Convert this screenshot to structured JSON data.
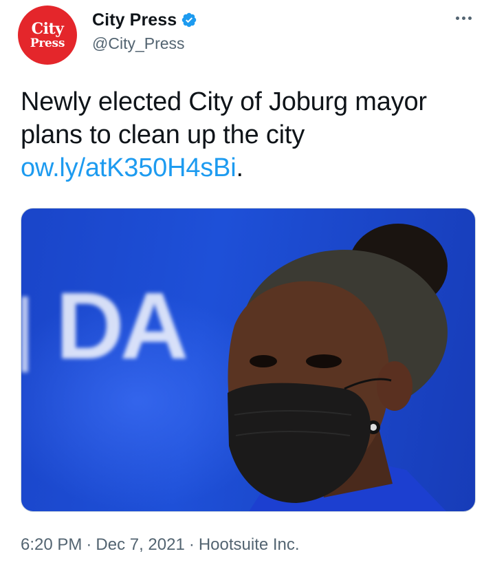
{
  "account": {
    "avatar_line1": "City",
    "avatar_line2": "Press",
    "display_name": "City Press",
    "handle": "@City_Press",
    "verified": true
  },
  "tweet": {
    "text": "Newly elected City of Joburg mayor plans to clean up the city ",
    "link": "ow.ly/atK350H4sBi",
    "trailing": "."
  },
  "media": {
    "sign_text": "DA",
    "description_icon": "photo"
  },
  "meta": {
    "time": "6:20 PM",
    "date": "Dec 7, 2021",
    "source": "Hootsuite Inc.",
    "separator": "·"
  },
  "colors": {
    "avatar_red": "#e4262b",
    "link_blue": "#1d9bf0",
    "muted": "#536471",
    "media_blue": "#1e50d8"
  }
}
